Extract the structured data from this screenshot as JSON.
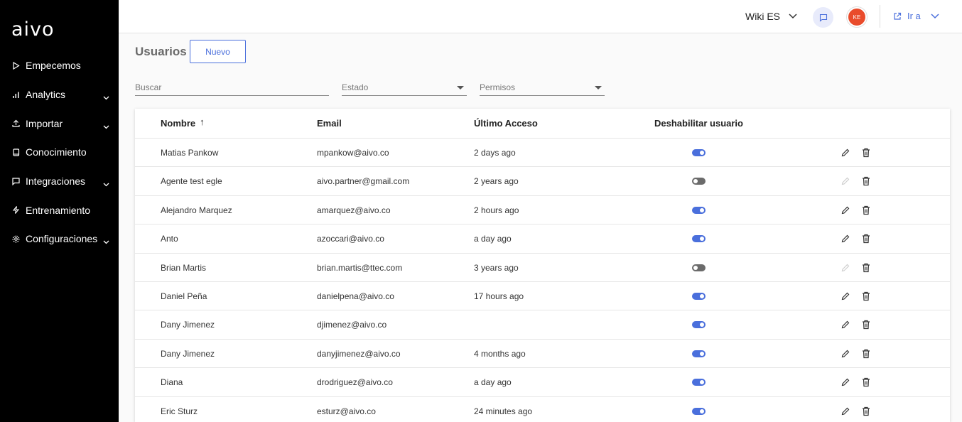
{
  "app": {
    "logo": "aivo"
  },
  "sidebar": {
    "items": [
      {
        "label": "Empecemos",
        "icon": "play-icon",
        "has_submenu": false
      },
      {
        "label": "Analytics",
        "icon": "bar-chart-icon",
        "has_submenu": true
      },
      {
        "label": "Importar",
        "icon": "upload-icon",
        "has_submenu": true
      },
      {
        "label": "Conocimiento",
        "icon": "book-icon",
        "has_submenu": false
      },
      {
        "label": "Integraciones",
        "icon": "chat-bubble-icon",
        "has_submenu": true
      },
      {
        "label": "Entrenamiento",
        "icon": "lightning-icon",
        "has_submenu": false
      },
      {
        "label": "Configuraciones",
        "icon": "gear-icon",
        "has_submenu": true
      }
    ]
  },
  "topbar": {
    "workspace": "Wiki ES",
    "avatar_initials": "KE",
    "goto_label": "Ir a"
  },
  "page": {
    "title": "Usuarios",
    "new_button": "Nuevo"
  },
  "filters": {
    "search_placeholder": "Buscar",
    "status_placeholder": "Estado",
    "permissions_placeholder": "Permisos"
  },
  "table": {
    "headers": {
      "name": "Nombre",
      "name_sort": "↑",
      "email": "Email",
      "last_access": "Último Acceso",
      "disable": "Deshabilitar usuario"
    },
    "rows": [
      {
        "name": "Matias Pankow",
        "email": "mpankow@aivo.co",
        "last_access": "2 days ago",
        "enabled": true,
        "editable": true
      },
      {
        "name": "Agente test egle",
        "email": "aivo.partner@gmail.com",
        "last_access": "2 years ago",
        "enabled": false,
        "editable": false
      },
      {
        "name": "Alejandro Marquez",
        "email": "amarquez@aivo.co",
        "last_access": "2 hours ago",
        "enabled": true,
        "editable": true
      },
      {
        "name": "Anto",
        "email": "azoccari@aivo.co",
        "last_access": "a day ago",
        "enabled": true,
        "editable": true
      },
      {
        "name": "Brian Martis",
        "email": "brian.martis@ttec.com",
        "last_access": "3 years ago",
        "enabled": false,
        "editable": false
      },
      {
        "name": "Daniel Peña",
        "email": "danielpena@aivo.co",
        "last_access": "17 hours ago",
        "enabled": true,
        "editable": true
      },
      {
        "name": "Dany Jimenez",
        "email": "djimenez@aivo.co",
        "last_access": "",
        "enabled": true,
        "editable": true
      },
      {
        "name": "Dany Jimenez",
        "email": "danyjimenez@aivo.co",
        "last_access": "4 months ago",
        "enabled": true,
        "editable": true
      },
      {
        "name": "Diana",
        "email": "drodriguez@aivo.co",
        "last_access": "a day ago",
        "enabled": true,
        "editable": true
      },
      {
        "name": "Eric Sturz",
        "email": "esturz@aivo.co",
        "last_access": "24 minutes ago",
        "enabled": true,
        "editable": true
      }
    ]
  },
  "colors": {
    "accent": "#4a6fdc",
    "sidebar_bg": "#000000",
    "avatar_bg": "#e94b2b",
    "toggle_off": "#6b6b6b"
  }
}
